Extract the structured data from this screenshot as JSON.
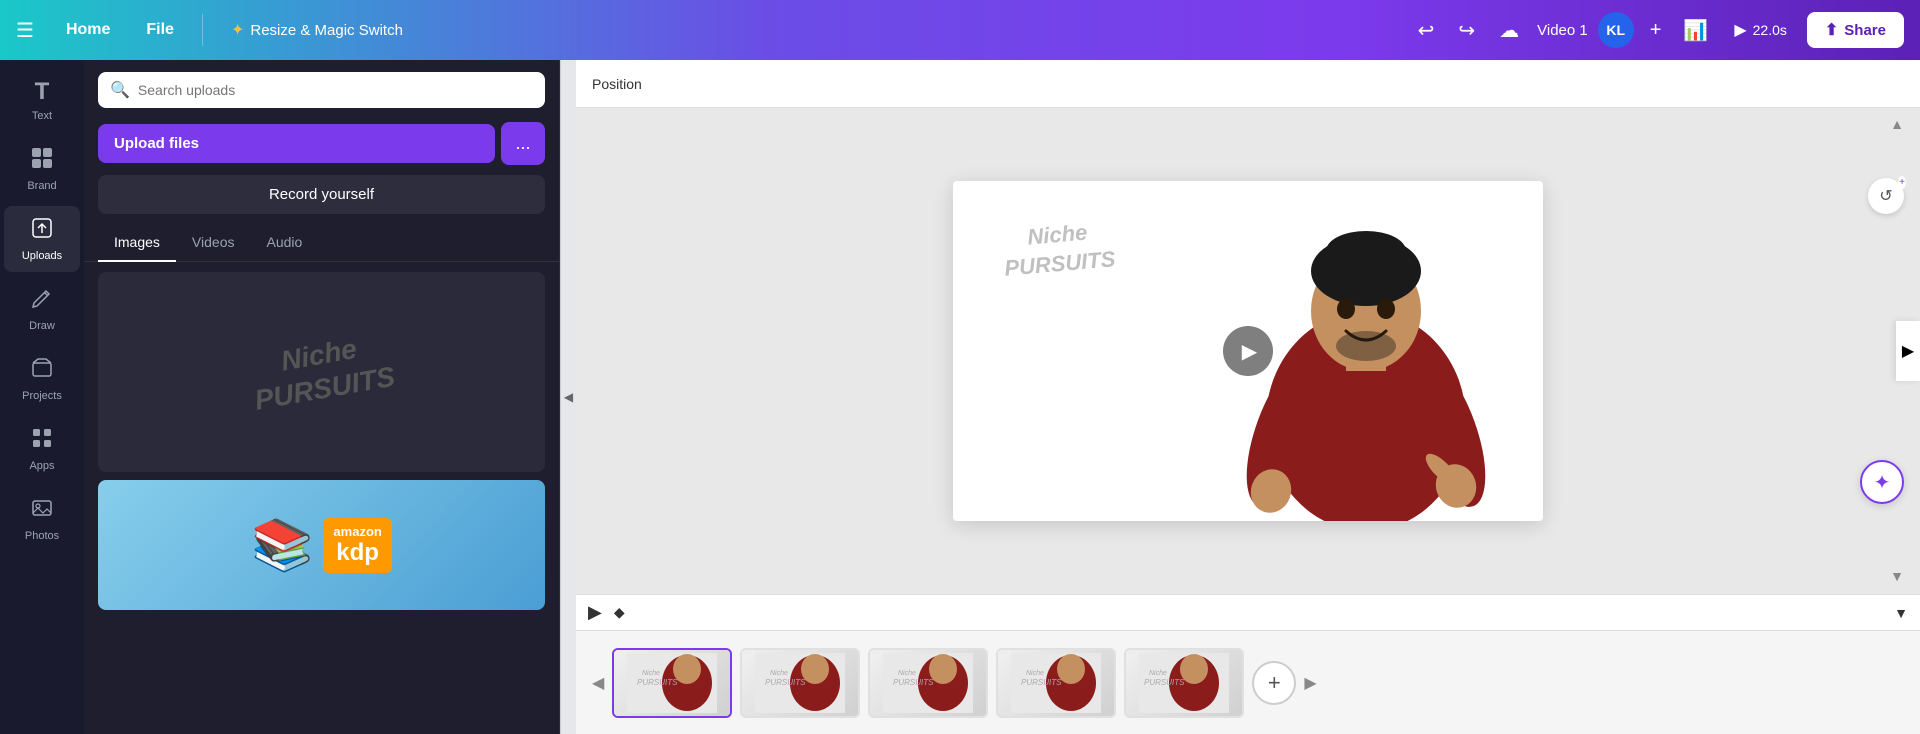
{
  "navbar": {
    "home_label": "Home",
    "file_label": "File",
    "resize_magic_label": "Resize & Magic Switch",
    "title": "Video 1",
    "avatar_initials": "KL",
    "duration": "22.0s",
    "share_label": "Share",
    "undo_symbol": "↩",
    "redo_symbol": "↪",
    "cloud_symbol": "☁"
  },
  "sidebar": {
    "items": [
      {
        "id": "text",
        "label": "Text",
        "icon": "T"
      },
      {
        "id": "brand",
        "label": "Brand",
        "icon": "🎨"
      },
      {
        "id": "uploads",
        "label": "Uploads",
        "icon": "⬆"
      },
      {
        "id": "draw",
        "label": "Draw",
        "icon": "✏"
      },
      {
        "id": "projects",
        "label": "Projects",
        "icon": "📁"
      },
      {
        "id": "apps",
        "label": "Apps",
        "icon": "⊞"
      },
      {
        "id": "photos",
        "label": "Photos",
        "icon": "🖼"
      }
    ]
  },
  "uploads_panel": {
    "search_placeholder": "Search uploads",
    "upload_files_label": "Upload files",
    "more_label": "...",
    "record_label": "Record yourself",
    "tabs": [
      {
        "id": "images",
        "label": "Images"
      },
      {
        "id": "videos",
        "label": "Videos"
      },
      {
        "id": "audio",
        "label": "Audio"
      }
    ],
    "active_tab": "images",
    "niche_watermark_line1": "Niche",
    "niche_watermark_line2": "PURSUITS",
    "amazon_top": "amazon",
    "amazon_bottom": "kdp"
  },
  "canvas": {
    "toolbar_label": "Position",
    "niche_line1": "Niche",
    "niche_line2": "PURSUITS",
    "refresh_icon": "↺",
    "magic_icon": "✦"
  },
  "timeline": {
    "play_icon": "▶",
    "add_icon": "+",
    "thumb_count": 5
  }
}
